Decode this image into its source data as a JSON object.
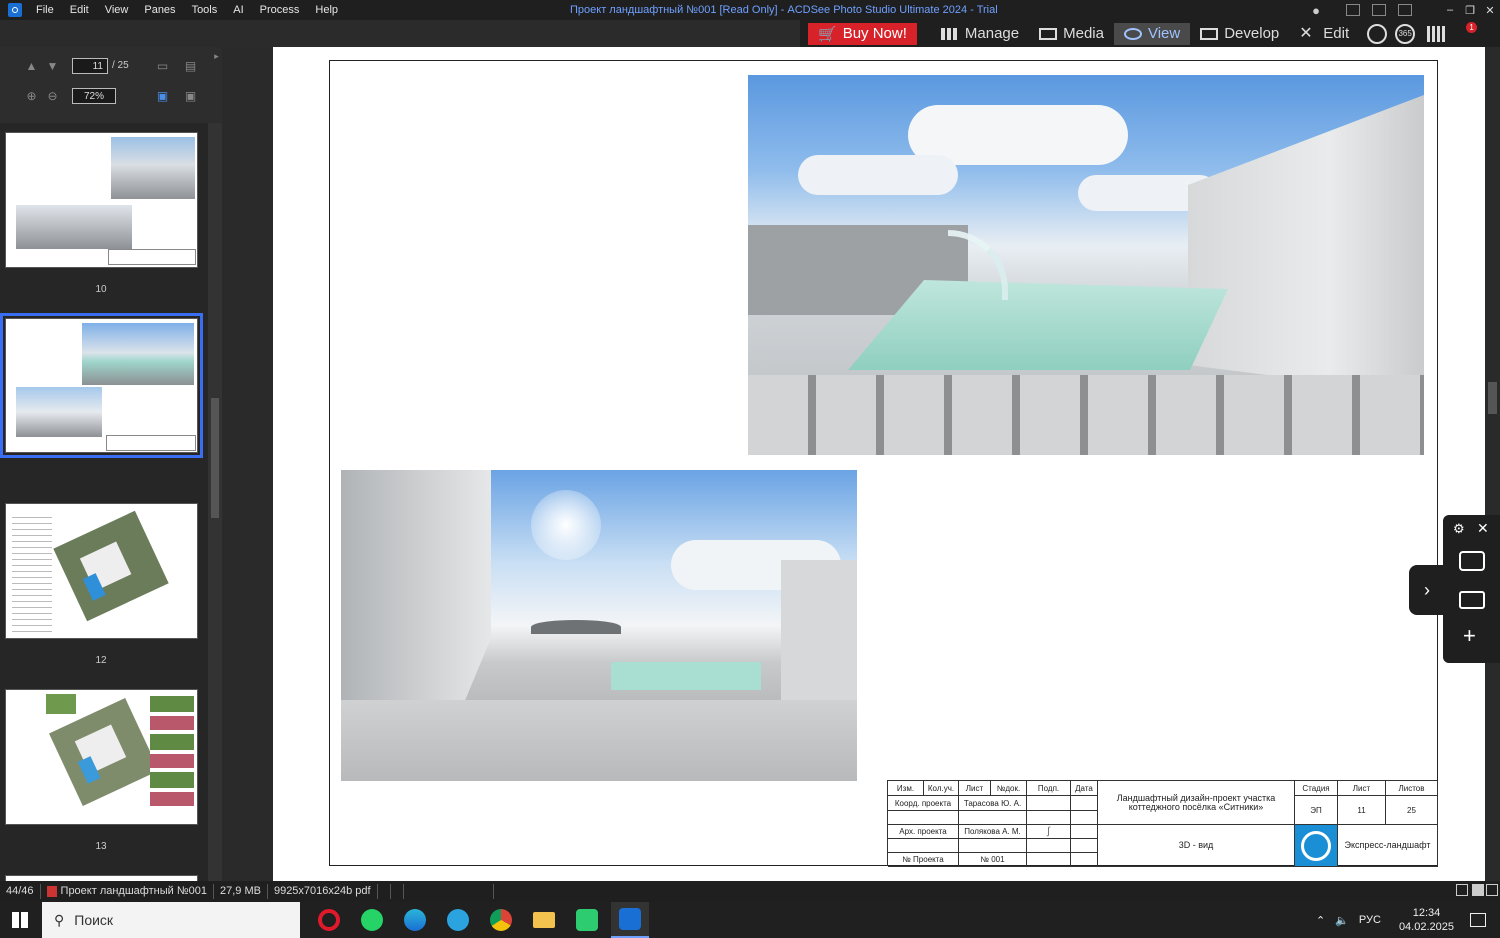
{
  "app": {
    "menu": [
      "File",
      "Edit",
      "View",
      "Panes",
      "Tools",
      "AI",
      "Process",
      "Help"
    ],
    "title": "Проект ландшафтный №001 [Read Only] - ACDSee Photo Studio Ultimate 2024 - Trial"
  },
  "modes": {
    "buy_now": "Buy Now!",
    "items": [
      "Manage",
      "Media",
      "View",
      "Develop",
      "Edit"
    ],
    "active": "View",
    "badge_365": "365",
    "notif_count": "1"
  },
  "sidebar": {
    "page_current": "11",
    "page_total": "/ 25",
    "zoom": "72%",
    "thumbnails": [
      {
        "number": "10",
        "selected": false
      },
      {
        "number": "",
        "selected": true
      },
      {
        "number": "12",
        "selected": false
      },
      {
        "number": "13",
        "selected": false
      }
    ]
  },
  "stamp": {
    "header": [
      "Изм.",
      "Кол.уч.",
      "Лист",
      "№док.",
      "Подп.",
      "Дата"
    ],
    "rows": [
      [
        "Коорд. проекта",
        "Тарасова Ю. А."
      ],
      [
        "Арх. проекта",
        "Полякова А. М."
      ],
      [
        "№ Проекта",
        "№ 001"
      ]
    ],
    "title": "Ландшафтный дизайн-проект участка коттеджного посёлка «Ситники»",
    "sheet_name": "3D - вид",
    "stage_label": "Стадия",
    "sheet_label": "Лист",
    "sheets_label": "Листов",
    "stage": "ЭП",
    "sheet": "11",
    "sheets": "25",
    "company": "Экспресс-ландшафт"
  },
  "status": {
    "count": "44/46",
    "file": "Проект ландшафтный №001",
    "size": "27,9 MB",
    "dims": "9925x7016x24b pdf"
  },
  "taskbar": {
    "search_placeholder": "Поиск",
    "lang": "РУС",
    "time": "12:34",
    "date": "04.02.2025"
  }
}
